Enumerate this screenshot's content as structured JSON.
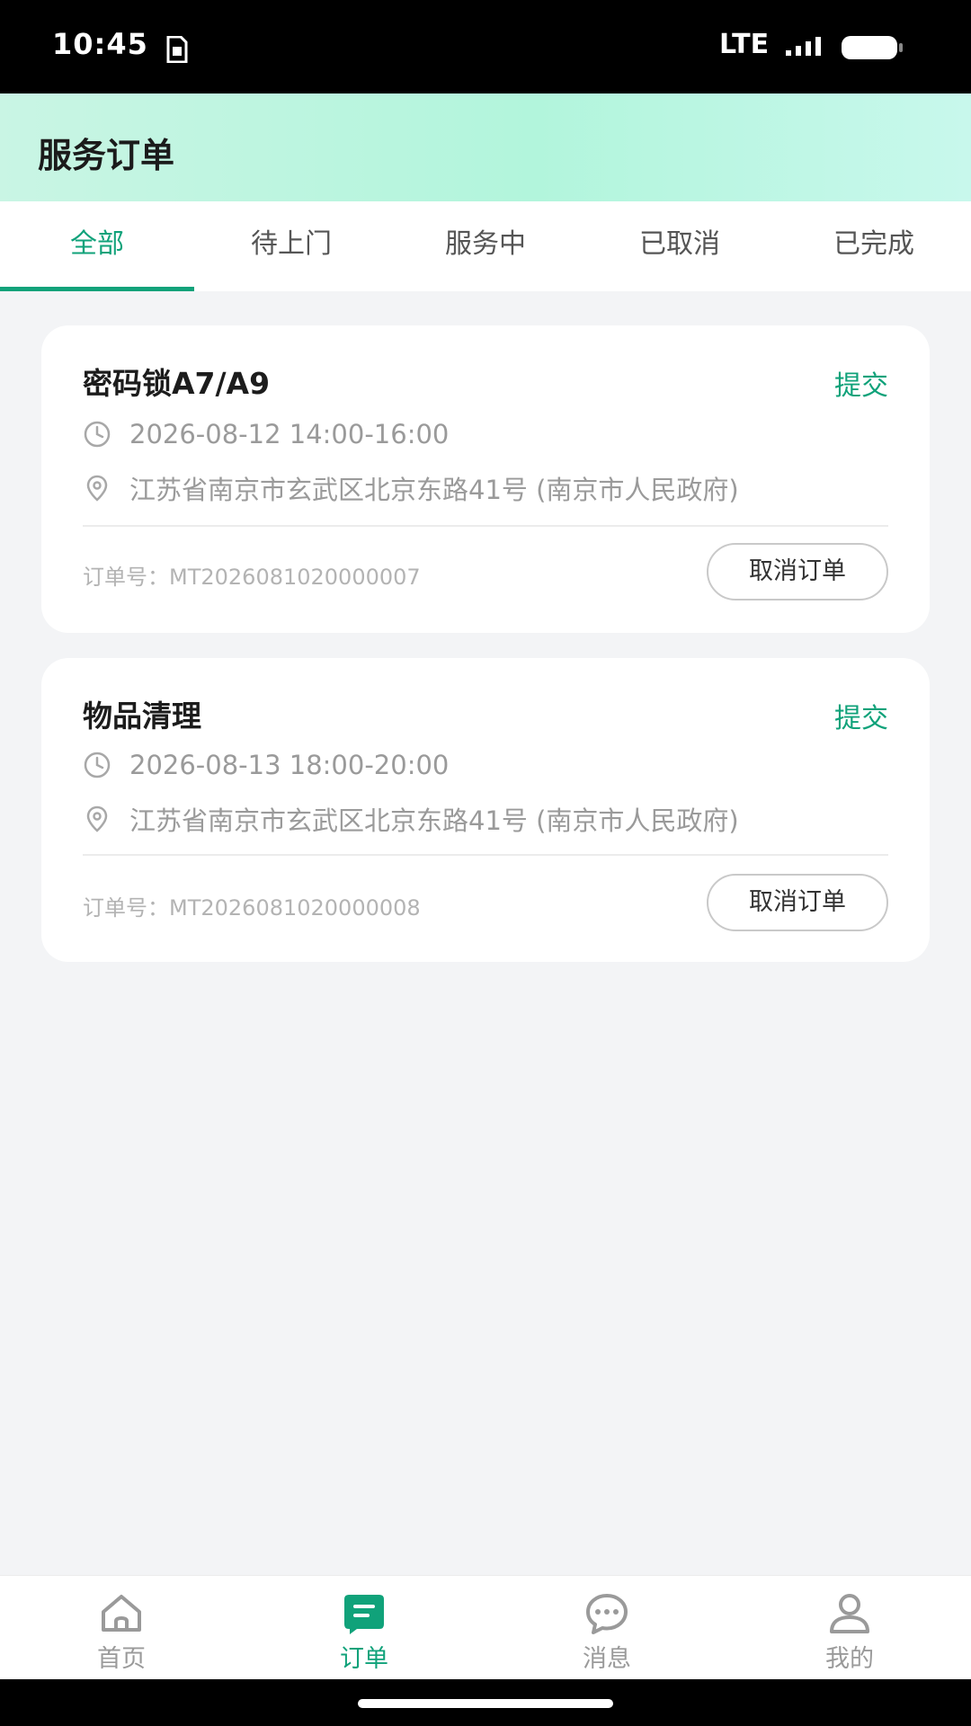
{
  "status_bar": {
    "time": "10:45",
    "network": "LTE"
  },
  "header": {
    "title": "服务订单"
  },
  "tabs": [
    {
      "label": "全部",
      "active": true
    },
    {
      "label": "待上门"
    },
    {
      "label": "服务中"
    },
    {
      "label": "已取消"
    },
    {
      "label": "已完成"
    }
  ],
  "orders": [
    {
      "title": "密码锁A7/A9",
      "status": "提交",
      "time": "2026-08-12 14:00-16:00",
      "address": "江苏省南京市玄武区北京东路41号 (南京市人民政府)",
      "order_no": "订单号：MT2026081020000007",
      "action": "取消订单"
    },
    {
      "title": "物品清理",
      "status": "提交",
      "time": "2026-08-13 18:00-20:00",
      "address": "江苏省南京市玄武区北京东路41号 (南京市人民政府)",
      "order_no": "订单号：MT2026081020000008",
      "action": "取消订单"
    }
  ],
  "bottom_nav": [
    {
      "label": "首页",
      "icon": "home-icon"
    },
    {
      "label": "订单",
      "icon": "order-icon",
      "active": true
    },
    {
      "label": "消息",
      "icon": "message-icon"
    },
    {
      "label": "我的",
      "icon": "profile-icon"
    }
  ],
  "colors": {
    "accent": "#10a27a",
    "header_bg": "#b2f5dc",
    "page_bg": "#f3f4f6"
  }
}
